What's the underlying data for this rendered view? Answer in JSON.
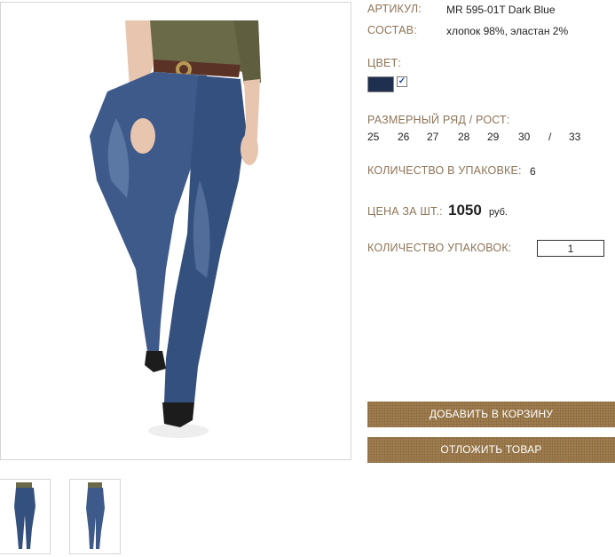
{
  "product": {
    "article_label": "АРТИКУЛ:",
    "article_value": "MR 595-01T Dark Blue",
    "composition_label": "СОСТАВ:",
    "composition_value": "хлопок 98%, эластан 2%",
    "color_label": "ЦВЕТ:",
    "color_swatch": "#1f2f4f",
    "color_checked_mark": "✓",
    "size_label": "РАЗМЕРНЫЙ РЯД / РОСТ:",
    "sizes": [
      "25",
      "26",
      "27",
      "28",
      "29",
      "30",
      "/",
      "33"
    ],
    "pack_qty_label": "КОЛИЧЕСТВО В УПАКОВКЕ:",
    "pack_qty_value": "6",
    "price_label": "ЦЕНА ЗА ШТ.:",
    "price_value": "1050",
    "price_currency": "руб.",
    "packs_label": "КОЛИЧЕСТВО УПАКОВОК:",
    "packs_value": "1"
  },
  "buttons": {
    "add_to_cart": "ДОБАВИТЬ В КОРЗИНУ",
    "postpone": "ОТЛОЖИТЬ ТОВАР"
  },
  "colors": {
    "label": "#8d7457",
    "button": "#a27f4f",
    "denim": "#3d5a8a",
    "top": "#6b6a48"
  }
}
